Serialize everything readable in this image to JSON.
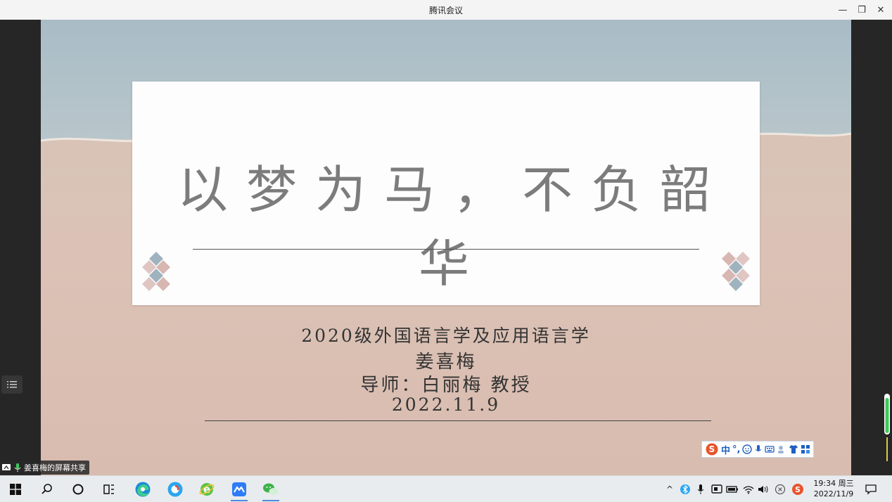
{
  "window": {
    "title": "腾讯会议",
    "minimize_glyph": "—",
    "restore_glyph": "❐",
    "close_glyph": "✕"
  },
  "slide": {
    "headline": "以梦为马，不负韶华",
    "class_line": "2020级外国语言学及应用语言学",
    "student": "姜喜梅",
    "advisor": "导师：白丽梅 教授",
    "date": "2022.11.9"
  },
  "share_label": "姜喜梅的屏幕共享",
  "ime": {
    "lang": "中",
    "punct": "°,"
  },
  "taskbar": {
    "apps": [
      "windows-start",
      "search",
      "cortana",
      "task-view",
      "edge",
      "browser-blue",
      "ie",
      "tencent-meeting",
      "wechat"
    ]
  },
  "tray": {
    "caret": "^",
    "time": "19:34 周三",
    "date": "2022/11/9"
  },
  "colors": {
    "accent": "#4c8bd8",
    "sogou": "#e8542c",
    "wechat": "#3cb34a",
    "meeting": "#2e7cf6",
    "volume": "#3cc85a"
  }
}
